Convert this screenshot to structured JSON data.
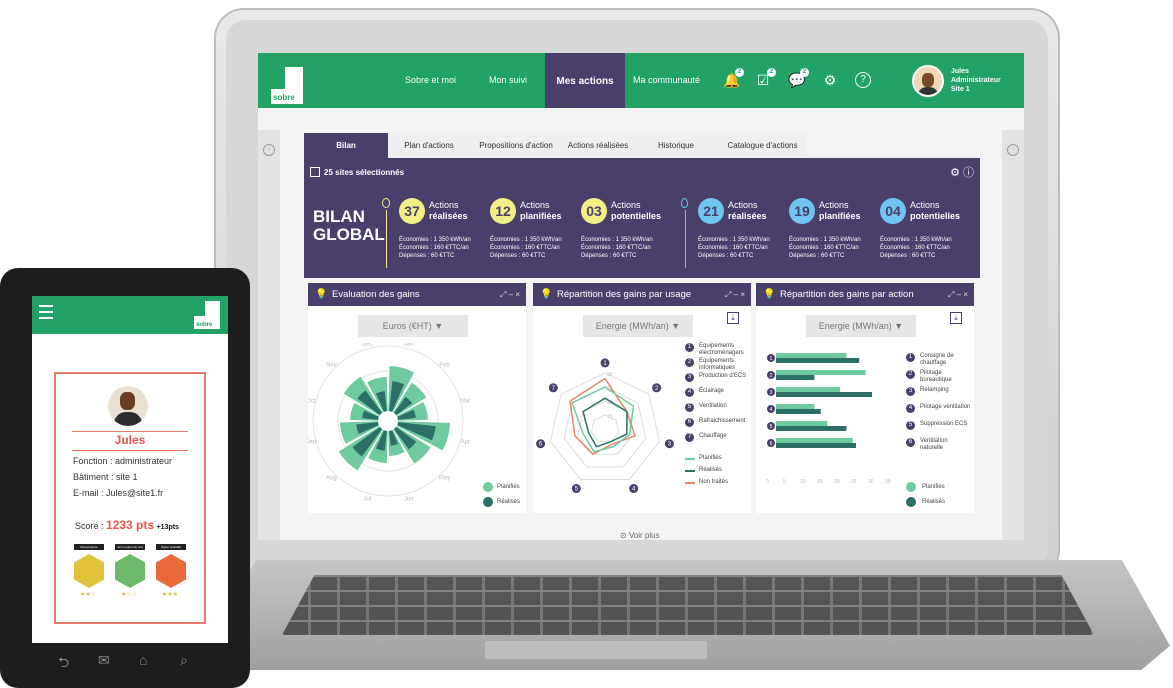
{
  "laptop": {
    "app": {
      "logo": "sobre"
    },
    "nav": [
      "Sobre et moi",
      "Mon suivi",
      "Mes actions",
      "Ma communauté"
    ],
    "header_icons": [
      {
        "icon": "bell-icon",
        "badge": "2"
      },
      {
        "icon": "checklist-icon",
        "badge": "2"
      },
      {
        "icon": "chat-icon",
        "badge": "2"
      },
      {
        "icon": "gear-icon"
      },
      {
        "icon": "help-icon"
      }
    ],
    "user": {
      "name": "Jules",
      "role": "Administrateur",
      "site": "Site 1"
    },
    "tabs": [
      "Bilan",
      "Plan d'actions",
      "Propositions d'action",
      "Actions réalisées",
      "Historique",
      "Catalogue d'actions"
    ],
    "summary": {
      "sites": "25 sites sélectionnés",
      "title_line1": "BILAN",
      "title_line2": "GLOBAL",
      "stats": [
        {
          "value": "37",
          "l1": "Actions",
          "l2": "réalisées",
          "color": "#f3ee85"
        },
        {
          "value": "12",
          "l1": "Actions",
          "l2": "planifiées",
          "color": "#f3ee85"
        },
        {
          "value": "03",
          "l1": "Actions",
          "l2": "potentielles",
          "color": "#f3ee85"
        },
        {
          "value": "21",
          "l1": "Actions",
          "l2": "réalisées",
          "color": "#6fc4f0"
        },
        {
          "value": "19",
          "l1": "Actions",
          "l2": "planifiées",
          "color": "#6fc4f0"
        },
        {
          "value": "04",
          "l1": "Actions",
          "l2": "potentielles",
          "color": "#6fc4f0"
        }
      ],
      "details": {
        "d1": "Économies : 1 350 kWh/an",
        "d2": "Économies : 160 €TTC/an",
        "d3": "Dépenses : 60 €TTC"
      }
    },
    "cards": {
      "c1": {
        "title": "Evaluation des gains",
        "select": "Euros (€HT)",
        "months": [
          "Jan",
          "Feb",
          "Mar",
          "Apr",
          "May",
          "Jun",
          "Jul",
          "Aug",
          "Sep",
          "Oct",
          "Nov",
          "Dec"
        ]
      },
      "c2": {
        "title": "Répartition des gains par usage",
        "select": "Energie (MWh/an)",
        "scale": [
          "30",
          "25",
          "20",
          "15"
        ],
        "legend": [
          "Equipements électroménagers",
          "Equipements informatiques",
          "Production d'ECS",
          "Éclairage",
          "Ventilation",
          "Rafraichissement",
          "Chauffage"
        ],
        "series": [
          "Planifiés",
          "Réalisés",
          "Non traités"
        ]
      },
      "c3": {
        "title": "Répartition des gains par action",
        "select": "Energie (MWh/an)",
        "legend": [
          "Consigne de chauffage",
          "Pilotage bureautique",
          "Relamping",
          "Pilotage ventilation",
          "Suppression ECS",
          "Ventilation naturelle"
        ],
        "xticks": [
          "0",
          "5",
          "10",
          "15",
          "20",
          "25",
          "30",
          "35"
        ]
      }
    },
    "legend_series": [
      "Planifiés",
      "Réalisés"
    ],
    "colors": {
      "green": "#22a264",
      "purple": "#4a3f6b",
      "teal_light": "#6fcaa0",
      "teal_dark": "#2b6f67",
      "orange": "#e8856b"
    },
    "voir_plus": "Voir plus"
  },
  "phone": {
    "logo": "sobre",
    "name": "Jules",
    "fonction": "Fonction : administrateur",
    "batiment": "Bâtiment : site 1",
    "email": "E-mail : Jules@site1.fr",
    "score_label": "Score :",
    "score": "1233 pts",
    "score_delta": "+13pts",
    "badges": [
      {
        "label": "Roucoutoute",
        "stars": "★★☆",
        "color": "#e0c23a"
      },
      {
        "label": "Anti rouleur de nuit",
        "stars": "★☆☆",
        "color": "#6db86a"
      },
      {
        "label": "Super soulstde",
        "stars": "★★★",
        "color": "#e86a3a"
      }
    ],
    "nav": [
      "back-icon",
      "mail-icon",
      "home-icon",
      "search-icon"
    ]
  }
}
